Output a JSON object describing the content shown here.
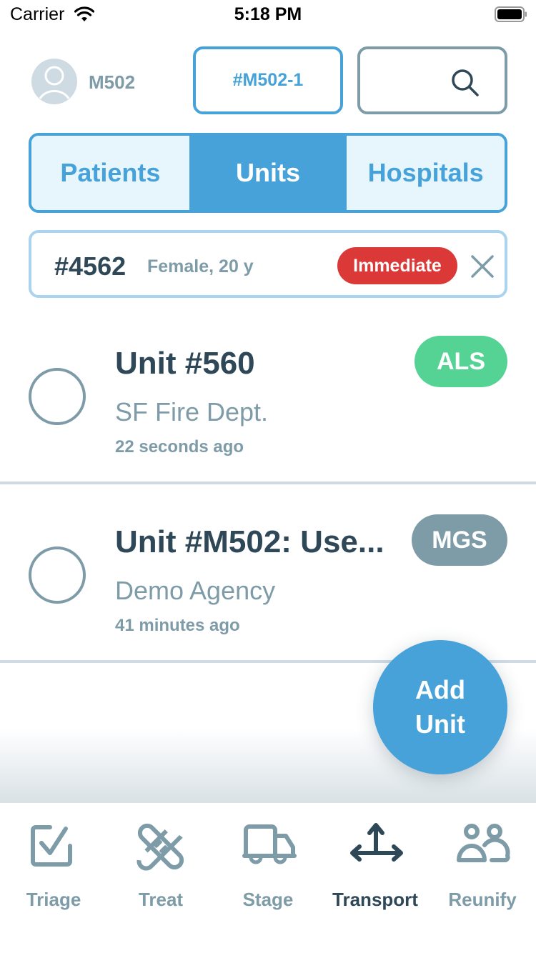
{
  "status_bar": {
    "carrier": "Carrier",
    "time": "5:18 PM",
    "wifi_icon": "wifi-icon",
    "battery_icon": "battery-icon"
  },
  "header": {
    "avatar_icon": "user-avatar-icon",
    "username": "M502",
    "incident_label": "#M502-1",
    "search_icon": "search-icon"
  },
  "tabs": [
    {
      "label": "Patients",
      "active": false
    },
    {
      "label": "Units",
      "active": true
    },
    {
      "label": "Hospitals",
      "active": false
    }
  ],
  "selected_patient": {
    "id": "#4562",
    "description": "Female, 20 y",
    "priority": "Immediate",
    "priority_color": "#db3838",
    "close_icon": "close-icon"
  },
  "units": [
    {
      "title": "Unit #560",
      "agency": "SF Fire Dept.",
      "updated": "22 seconds ago",
      "badge": "ALS",
      "badge_color": "#54d394",
      "selected": false
    },
    {
      "title": "Unit #M502: Use...",
      "agency": "Demo Agency",
      "updated": "41 minutes ago",
      "badge": "MGS",
      "badge_color": "#7e9ba8",
      "selected": false
    }
  ],
  "fab": {
    "line1": "Add",
    "line2": "Unit"
  },
  "nav": [
    {
      "label": "Triage",
      "icon": "checkbox-icon",
      "active": false
    },
    {
      "label": "Treat",
      "icon": "bandage-icon",
      "active": false
    },
    {
      "label": "Stage",
      "icon": "truck-icon",
      "active": false
    },
    {
      "label": "Transport",
      "icon": "arrows-icon",
      "active": true
    },
    {
      "label": "Reunify",
      "icon": "people-icon",
      "active": false
    }
  ],
  "colors": {
    "primary": "#46a2d9",
    "dark": "#2f4858",
    "muted": "#7e9ba8",
    "light_blue": "#e7f5fd",
    "divider": "#cfdbe2"
  }
}
